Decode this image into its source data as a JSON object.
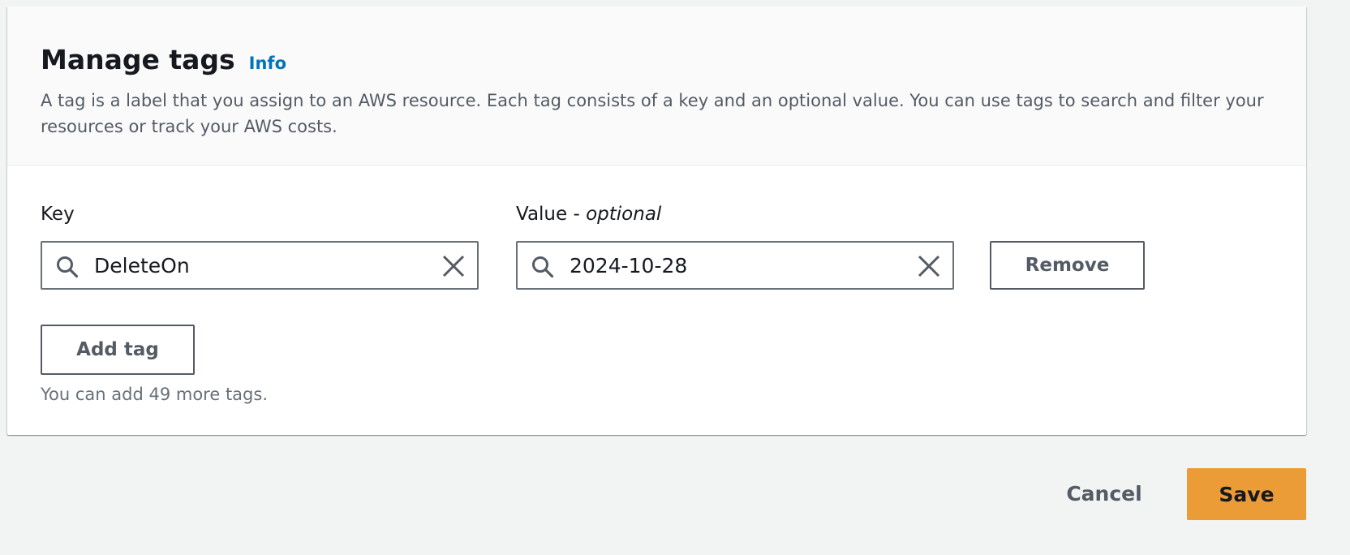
{
  "header": {
    "title": "Manage tags",
    "info_link": "Info",
    "description": "A tag is a label that you assign to an AWS resource. Each tag consists of a key and an optional value. You can use tags to search and filter your resources or track your AWS costs."
  },
  "tags": [
    {
      "key_label": "Key",
      "value_label": "Value - ",
      "value_label_optional": "optional",
      "key": "DeleteOn",
      "value": "2024-10-28",
      "remove_label": "Remove"
    }
  ],
  "add_tag_label": "Add tag",
  "hint": "You can add 49 more tags.",
  "footer": {
    "cancel_label": "Cancel",
    "save_label": "Save"
  },
  "colors": {
    "primary_button": "#ec9c36",
    "link": "#0073bb",
    "background": "#f2f3f3"
  },
  "icons": [
    "search-icon",
    "clear-icon"
  ]
}
